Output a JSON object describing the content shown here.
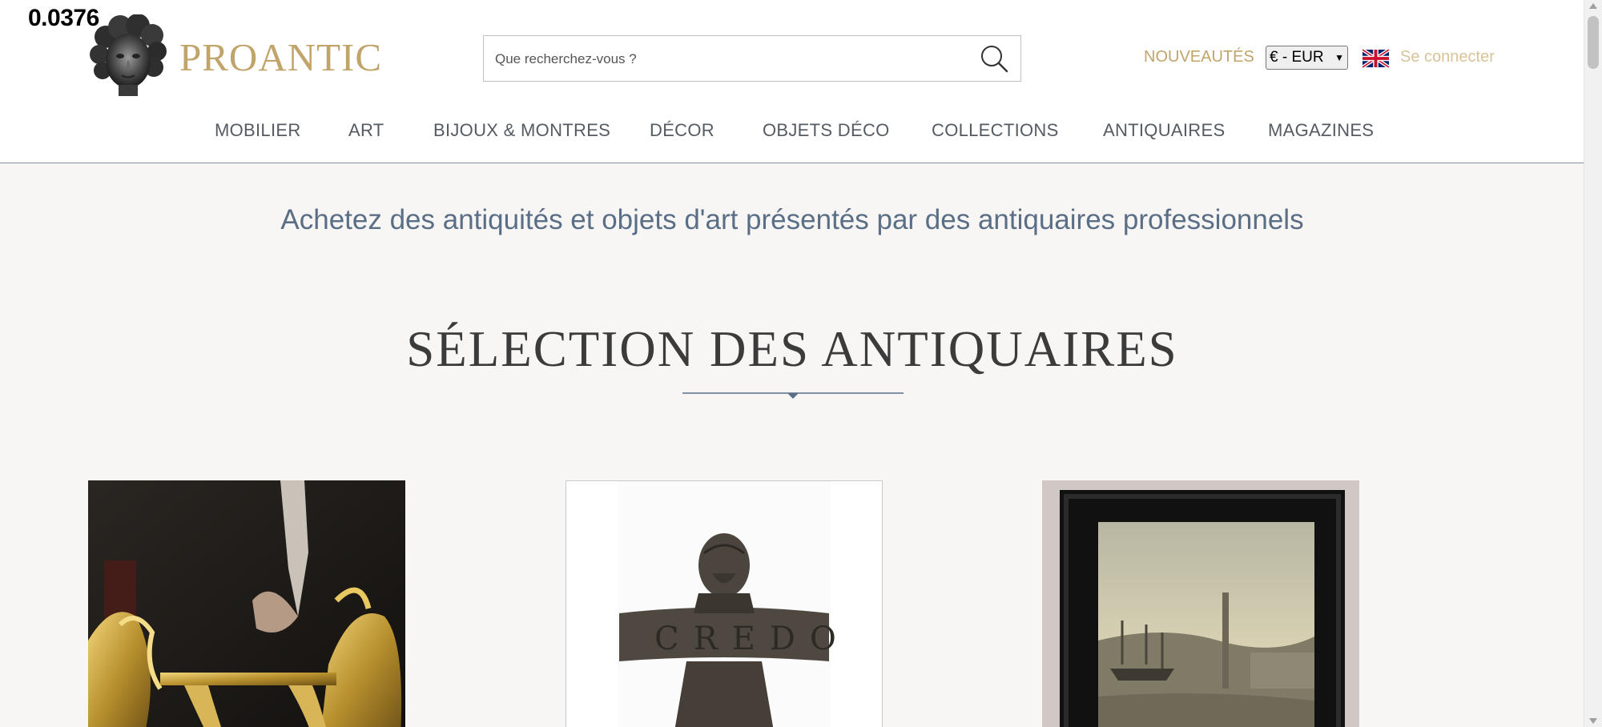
{
  "overlay": {
    "value": "0.0376"
  },
  "header": {
    "brand": "PROANTIC",
    "logo_icon": "sculpted-head-logo",
    "search": {
      "placeholder": "Que recherchez-vous ?",
      "icon": "search-icon"
    },
    "nouveautes_label": "NOUVEAUTÉS",
    "currency_selected": "€ - EUR",
    "flag_icon": "uk-flag-icon",
    "login_label": "Se connecter"
  },
  "nav": {
    "items": [
      {
        "label": "MOBILIER"
      },
      {
        "label": "ART"
      },
      {
        "label": "BIJOUX & MONTRES"
      },
      {
        "label": "DÉCOR"
      },
      {
        "label": "OBJETS DÉCO"
      },
      {
        "label": "COLLECTIONS"
      },
      {
        "label": "ANTIQUAIRES"
      },
      {
        "label": "MAGAZINES"
      }
    ]
  },
  "hero": {
    "tagline": "Achetez des antiquités et objets d'art présentés par des antiquaires professionnels",
    "section_title": "SÉLECTION DES ANTIQUAIRES"
  },
  "products": [
    {
      "image": "gilt-bronze-firedogs-image"
    },
    {
      "image": "bronze-credo-sculpture-image"
    },
    {
      "image": "framed-harbor-painting-image"
    }
  ],
  "colors": {
    "brand_gold": "#c0a46a",
    "login_gold": "#d8c39a",
    "tagline_blue": "#5a6e86",
    "header_border": "#7f93aa",
    "page_bg": "#f7f6f5"
  }
}
